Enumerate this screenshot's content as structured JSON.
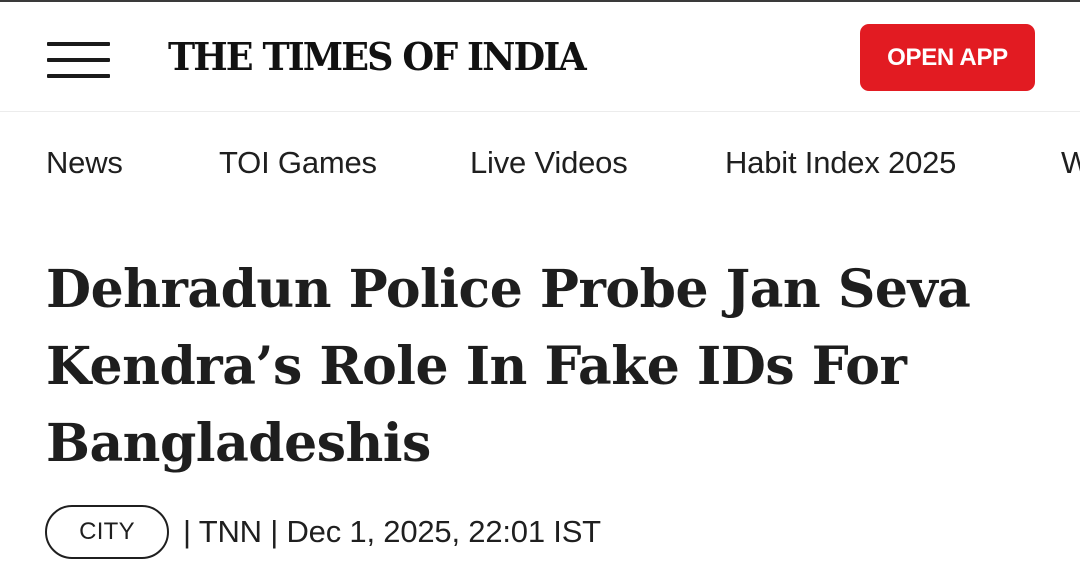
{
  "header": {
    "logo_text": "THE TIMES OF INDIA",
    "open_app_label": "OPEN APP",
    "menu_icon": "hamburger-menu-icon",
    "accent_color": "#e21b22"
  },
  "nav": {
    "items": [
      {
        "label": "News"
      },
      {
        "label": "TOI Games"
      },
      {
        "label": "Live Videos"
      },
      {
        "label": "Habit Index 2025"
      },
      {
        "label": "W"
      }
    ]
  },
  "article": {
    "headline_lines": [
      "Dehradun Police Probe Jan Seva",
      "Kendra’s Role In Fake IDs For",
      "Bangladeshis"
    ],
    "category": "CITY",
    "byline": "| TNN | Dec 1, 2025, 22:01 IST"
  }
}
